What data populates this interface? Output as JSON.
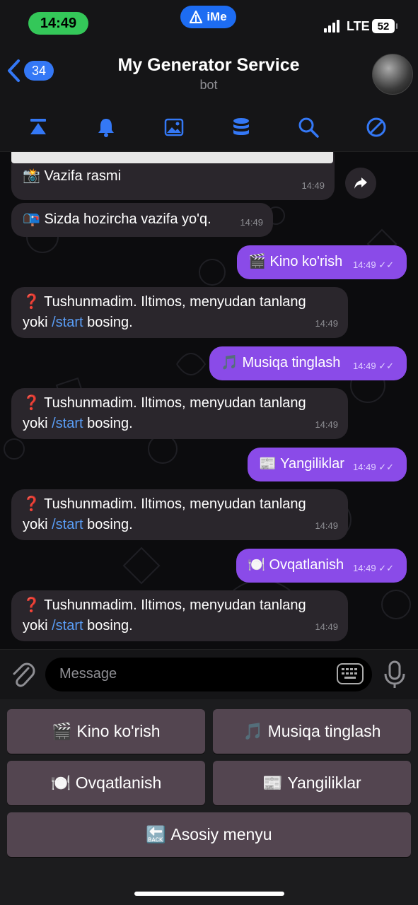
{
  "status": {
    "time": "14:49",
    "ime_label": "iMe",
    "network": "LTE",
    "battery": "52"
  },
  "header": {
    "back_count": "34",
    "title": "My Generator Service",
    "subtitle": "bot"
  },
  "toolbar": {
    "icons": [
      "pin-icon",
      "bell-icon",
      "gallery-icon",
      "database-icon",
      "search-icon",
      "block-icon"
    ]
  },
  "colors": {
    "accent": "#3478f6",
    "outgoing": "#8a4be8",
    "incoming": "#2a262c",
    "link": "#5a9df5",
    "keyboard_button": "#534550"
  },
  "messages": [
    {
      "dir": "in",
      "emoji": "📸",
      "text": "Vazifa rasmi",
      "time": "14:49"
    },
    {
      "dir": "in",
      "emoji": "📭",
      "text": "Sizda hozircha vazifa yo'q.",
      "time": "14:49"
    },
    {
      "dir": "out",
      "emoji": "🎬",
      "text": "Kino ko'rish",
      "time": "14:49"
    },
    {
      "dir": "in",
      "emoji": "❓",
      "text": "Tushunmadim. Iltimos, menyudan tanlang",
      "line2_pre": "yoki ",
      "cmd": "/start",
      "line2_post": " bosing.",
      "time": "14:49"
    },
    {
      "dir": "out",
      "emoji": "🎵",
      "text": "Musiqa tinglash",
      "time": "14:49"
    },
    {
      "dir": "in",
      "emoji": "❓",
      "text": "Tushunmadim. Iltimos, menyudan tanlang",
      "line2_pre": "yoki ",
      "cmd": "/start",
      "line2_post": " bosing.",
      "time": "14:49"
    },
    {
      "dir": "out",
      "emoji": "📰",
      "text": "Yangiliklar",
      "time": "14:49"
    },
    {
      "dir": "in",
      "emoji": "❓",
      "text": "Tushunmadim. Iltimos, menyudan tanlang",
      "line2_pre": "yoki ",
      "cmd": "/start",
      "line2_post": " bosing.",
      "time": "14:49"
    },
    {
      "dir": "out",
      "emoji": "🍽️",
      "text": "Ovqatlanish",
      "time": "14:49"
    },
    {
      "dir": "in",
      "emoji": "❓",
      "text": "Tushunmadim. Iltimos, menyudan tanlang",
      "line2_pre": "yoki ",
      "cmd": "/start",
      "line2_post": " bosing.",
      "time": "14:49"
    }
  ],
  "composer": {
    "placeholder": "Message"
  },
  "keyboard": {
    "buttons": [
      {
        "emoji": "🎬",
        "label": "Kino ko'rish"
      },
      {
        "emoji": "🎵",
        "label": "Musiqa tinglash"
      },
      {
        "emoji": "🍽️",
        "label": "Ovqatlanish"
      },
      {
        "emoji": "📰",
        "label": "Yangiliklar"
      },
      {
        "emoji": "🔙",
        "label": "Asosiy menyu"
      }
    ]
  }
}
